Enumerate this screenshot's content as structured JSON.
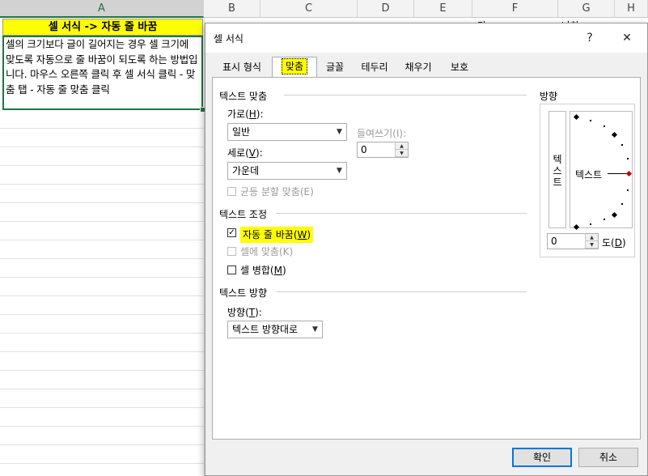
{
  "sheet": {
    "columns": [
      "A",
      "B",
      "C",
      "D",
      "E",
      "F",
      "G",
      "H"
    ],
    "cell_a1": "셀 서식 -> 자동 줄 바꿈",
    "cell_a2": "셀의 크기보다 글이 길어지는 경우 셀 크기에 맞도록 자동으로 줄 바꿈이 되도록 하는 방법입니다. 마우스 오른쪽 클릭 후 셀 서식 클릭 - 맞춤 탭 - 자동 줄 맞춤 클릭",
    "peek_f": "가",
    "peek_g": "나하"
  },
  "dialog": {
    "title": "셀 서식",
    "help": "?",
    "close": "✕",
    "tabs": [
      "표시 형식",
      "맞춤",
      "글꼴",
      "테두리",
      "채우기",
      "보호"
    ],
    "text_align": {
      "group": "텍스트 맞춤",
      "horizontal_label": "가로(",
      "horizontal_key": "H",
      "horizontal_value": "일반",
      "indent_label": "들여쓰기(I):",
      "indent_value": "0",
      "vertical_label": "세로(",
      "vertical_key": "V",
      "vertical_value": "가운데",
      "distributed": "균등 분할 맞춤(E)"
    },
    "text_control": {
      "group": "텍스트 조정",
      "wrap": "자동 줄 바꿈(",
      "wrap_key": "W",
      "wrap_checked": true,
      "shrink": "셀에 맞춤(K)",
      "merge": "셀 병합(",
      "merge_key": "M"
    },
    "text_direction": {
      "group": "텍스트 방향",
      "label": "방향(",
      "label_key": "T",
      "value": "텍스트 방향대로"
    },
    "orientation": {
      "group": "방향",
      "vertical_text": "텍\n스\n트",
      "horizontal_text": "텍스트",
      "degrees": "0",
      "degrees_label": "도(",
      "degrees_key": "D"
    },
    "ok": "확인",
    "cancel": "취소"
  }
}
